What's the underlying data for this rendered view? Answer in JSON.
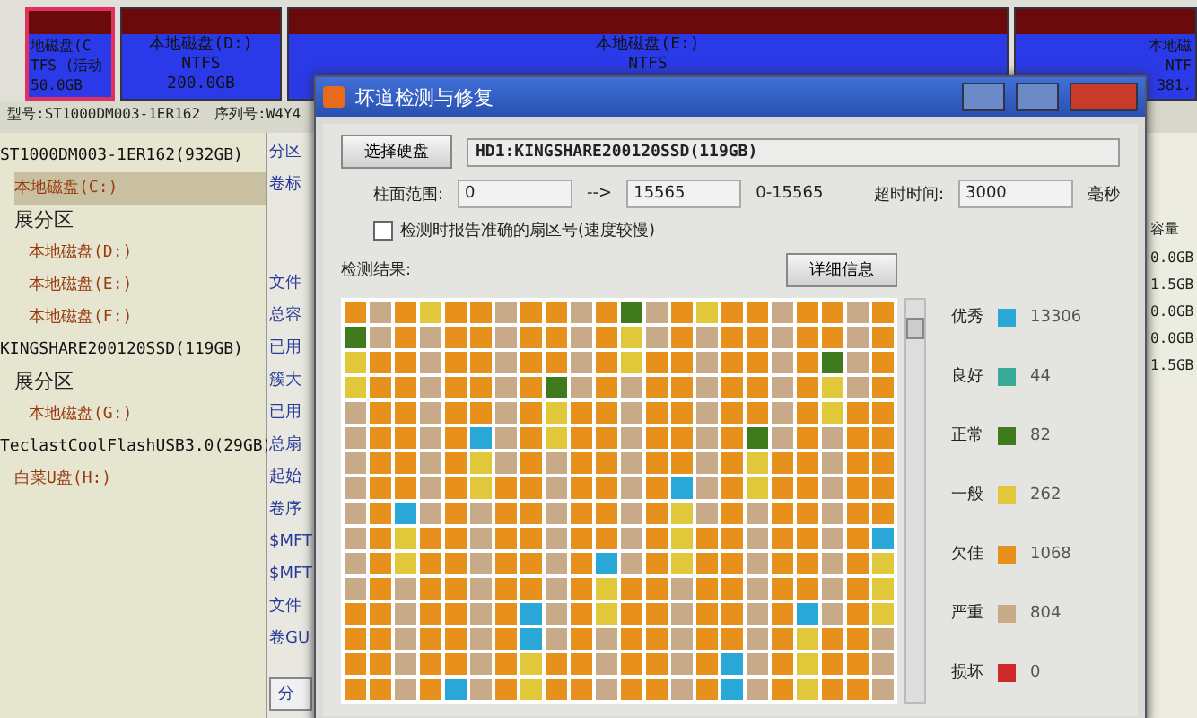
{
  "partition_bar": [
    {
      "name": "地磁盘(C",
      "fs": "TFS (活动",
      "size": "50.0GB",
      "selected": true
    },
    {
      "name": "本地磁盘(D:)",
      "fs": "NTFS",
      "size": "200.0GB",
      "selected": false
    },
    {
      "name": "本地磁盘(E:)",
      "fs": "NTFS",
      "selected": false
    },
    {
      "name": "本地磁",
      "fs": "NTF",
      "size": "381.",
      "selected": false
    }
  ],
  "disk_info": {
    "model": "型号:ST1000DM003-1ER162",
    "serial": "序列号:W4Y4"
  },
  "tree": [
    {
      "label": "ST1000DM003-1ER162(932GB)",
      "kind": "disk",
      "children": [
        {
          "label": "本地磁盘(C:)",
          "kind": "partition",
          "selected": true
        },
        {
          "label": "展分区",
          "kind": "extended",
          "children": [
            {
              "label": "本地磁盘(D:)",
              "kind": "partition",
              "selected": false
            },
            {
              "label": "本地磁盘(E:)",
              "kind": "partition",
              "selected": false
            },
            {
              "label": "本地磁盘(F:)",
              "kind": "partition",
              "selected": false
            }
          ]
        }
      ]
    },
    {
      "label": "KINGSHARE200120SSD(119GB)",
      "kind": "disk",
      "children": [
        {
          "label": "展分区",
          "kind": "extended",
          "children": [
            {
              "label": "本地磁盘(G:)",
              "kind": "partition",
              "selected": false
            }
          ]
        }
      ]
    },
    {
      "label": "TeclastCoolFlashUSB3.0(29GB)",
      "kind": "disk",
      "children": [
        {
          "label": "白菜U盘(H:)",
          "kind": "partition",
          "selected": false
        }
      ]
    }
  ],
  "middle_panel": {
    "tab": "分区",
    "label_top": "卷标",
    "labels": [
      "文件",
      "总容",
      "已用",
      "簇大",
      "已用",
      "总扇",
      "起始",
      "卷序",
      "$MFT",
      "$MFT",
      "文件",
      "卷GU"
    ],
    "button": "分"
  },
  "capacity_column": {
    "header": "容量",
    "values": [
      "0.0GB",
      "1.5GB",
      "0.0GB",
      "0.0GB",
      "1.5GB"
    ]
  },
  "dialog": {
    "title": "坏道检测与修复",
    "select_button": "选择硬盘",
    "disk": "HD1:KINGSHARE200120SSD(119GB)",
    "cylinder_label": "柱面范围:",
    "cyl_from": "0",
    "arrow": "-->",
    "cyl_to": "15565",
    "cyl_range": "0-15565",
    "timeout_label": "超时时间:",
    "timeout": "3000",
    "timeout_unit": "毫秒",
    "report_exact": {
      "label": "检测时报告准确的扇区号(速度较慢)",
      "checked": false
    },
    "results_label": "检测结果:",
    "details_button": "详细信息",
    "legend": [
      {
        "label": "优秀",
        "color": "#29a8d8",
        "count": "13306"
      },
      {
        "label": "良好",
        "color": "#3aaa98",
        "count": "44"
      },
      {
        "label": "正常",
        "color": "#3f7a1c",
        "count": "82"
      },
      {
        "label": "一般",
        "color": "#e0c83a",
        "count": "262"
      },
      {
        "label": "欠佳",
        "color": "#e8901c",
        "count": "1068"
      },
      {
        "label": "严重",
        "color": "#c8aa88",
        "count": "804"
      },
      {
        "label": "损坏",
        "color": "#d02828",
        "count": "0"
      }
    ]
  }
}
